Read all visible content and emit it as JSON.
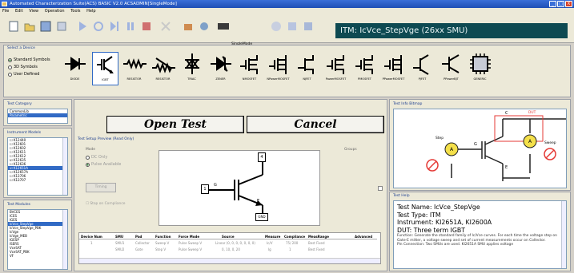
{
  "window": {
    "title": "Automated Characterization Suite(ACS) BASIC V2.0   ACSADMIN[SingleMode]",
    "btn_min": "_",
    "btn_max": "□",
    "btn_close": "X"
  },
  "menu": [
    "File",
    "Edit",
    "View",
    "Operation",
    "Tools",
    "Help"
  ],
  "toolbar": {
    "mode_label": "SingleMode"
  },
  "itm_title": "ITM: IcVce_StepVge (26xx SMU)",
  "device_panel": {
    "title": "Select a Device",
    "radios": [
      "Standard Symbols",
      "3D Symbols",
      "User Defined"
    ],
    "devices": [
      "DIODE",
      "IGBT",
      "RESISTOR",
      "RESISTOR",
      "TRIAC",
      "ZENER",
      "NMOSFET",
      "NPowerMOSFET",
      "NJFET",
      "PowerMOSFET",
      "PMOSFET",
      "PPowerMOSFET",
      "PJFET",
      "PPowerBJT",
      "GENERIC"
    ]
  },
  "test_category": {
    "title": "Test Category",
    "items": [
      "CommonLib",
      "Parametric"
    ]
  },
  "instrument_models": {
    "title": "Instrument Models",
    "items": [
      "K12440",
      "K12601",
      "K12602",
      "K12611",
      "K12612",
      "K12635",
      "K12636",
      "K12651A",
      "K12657A",
      "K13706",
      "K13707"
    ]
  },
  "test_modules": {
    "title": "Test Modules",
    "items": [
      "BVCES",
      "ICES",
      "IGES",
      "IcVce_StepVge",
      "IcVce_StepVge_PBK",
      "IcVge",
      "IcVge_MEB",
      "IGESP",
      "ISERS",
      "VceSAT",
      "VceSAT_PBK",
      "VF"
    ]
  },
  "center": {
    "open_label": "Open Test",
    "cancel_label": "Cancel",
    "preview_title": "Test Setup Preview (Read Only)",
    "mode_title": "Mode",
    "mode_opts": [
      "DC Only",
      "Pulse Available"
    ],
    "timing_label": "Timing",
    "compliance_label": "Stop on Compliance",
    "groups_label": "Groups",
    "node1": "1",
    "node4": "4",
    "node_g": "G",
    "node_e": "E",
    "gnd": "GND",
    "columns": [
      "Device Num",
      "SMU",
      "Pad",
      "Function",
      "Force Mode",
      "Source",
      "Measure",
      "Compliance",
      "MeasRange",
      "Advanced"
    ],
    "rows": [
      [
        "1",
        "SMU1",
        "Collector",
        "Sweep V",
        "Pulse Sweep V",
        "Linear (0, 0, 0, 0, 0, 0, 0)",
        "Ic/V",
        "75/ 200",
        "Best Fixed",
        ""
      ],
      [
        "",
        "SMU2",
        "Gate",
        "Step V",
        "Pulse Sweep V",
        "0, 10, 0, 20",
        "Ig",
        "1",
        "Best Fixed",
        ""
      ]
    ]
  },
  "test_info_bitmap": {
    "title": "Test Info Bitmap",
    "step_label": "Step",
    "sweep_label": "Sweep",
    "dut_label": "DUT",
    "labels": {
      "c": "C",
      "g": "G",
      "e": "E"
    }
  },
  "test_help": {
    "title": "Test Help",
    "name": "Test Name: IcVce_StepVge",
    "type": "Test Type: ITM",
    "instrument": "Instrument: KI2651A, KI2600A",
    "dut": "DUT: Three term IGBT",
    "function": "Function: Generate the standard family of Ic/Vce curves. For each time the voltage step on Gate-E mitter, a voltage sweep and set of current measurements occur on Collector.",
    "pin": "Pin Connection: Two SMUs are used. KI2651A SMU applies voltage"
  },
  "colors": {
    "itm_bg": "#0e4a52",
    "title_bg": "#2557c4",
    "select": "#316ac5"
  }
}
